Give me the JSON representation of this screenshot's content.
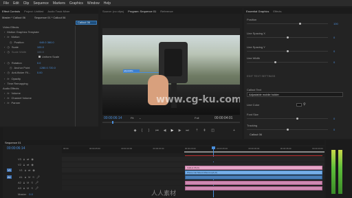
{
  "menubar": {
    "items": [
      "File",
      "Edit",
      "Clip",
      "Sequence",
      "Markers",
      "Graphics",
      "Window",
      "Help"
    ]
  },
  "effect_controls": {
    "tabs": [
      "Effect Controls",
      "Project: Untitled",
      "Audio Track Mixer"
    ],
    "header": {
      "master": "Master * Callout 06",
      "sequence": "Sequence 01 * Callout 06"
    },
    "clip_label": "Callout 06",
    "section_video": "Video Effects",
    "items": [
      {
        "label": "Motion Graphics Template",
        "value": ""
      },
      {
        "label": "Motion",
        "value": ""
      },
      {
        "label": "Position",
        "value": "640.0   360.0"
      },
      {
        "label": "Scale",
        "value": "100.0"
      },
      {
        "label": "Scale Width",
        "value": "100.0"
      },
      {
        "label": "Uniform Scale",
        "value": ""
      },
      {
        "label": "Rotation",
        "value": "0.0"
      },
      {
        "label": "Anchor Point",
        "value": "1280.0   720.0"
      },
      {
        "label": "Anti-flicker Fil...",
        "value": "0.00"
      },
      {
        "label": "Opacity",
        "value": ""
      },
      {
        "label": "Time Remapping",
        "value": ""
      }
    ],
    "section_audio": "Audio Effects",
    "audio_items": [
      "Volume",
      "Channel Volume",
      "Panner"
    ]
  },
  "program_monitor": {
    "tabs": [
      "Source: (no clips)",
      "Program: Sequence 01",
      "Reference"
    ],
    "timecode": "00:00:06:14",
    "fit": "Fit",
    "quality": "Full",
    "duration": "00:00:04:01",
    "watermark": "www.cg-ku.com",
    "callout_bar": "adjustable"
  },
  "essential_graphics": {
    "tabs": [
      "Essential Graphics",
      "Effects"
    ],
    "fields": [
      {
        "label": "Position",
        "value": "100"
      },
      {
        "label": "Line Spacing X",
        "value": "0"
      },
      {
        "label": "Line Spacing Y",
        "value": "0"
      },
      {
        "label": "Line Width",
        "value": "0"
      },
      {
        "label": "EDIT TEXT SETTINGS",
        "value": ""
      },
      {
        "label": "Callout Text",
        "value": "Adjustable mobile holder"
      },
      {
        "label": "Line Color",
        "value": ""
      },
      {
        "label": "Font Size",
        "value": "0"
      },
      {
        "label": "Tracking",
        "value": "0"
      }
    ],
    "footer_clip": "Callout 06"
  },
  "timeline": {
    "tab": "Sequence 01",
    "timecode": "00:00:06:14",
    "ruler": [
      "00:00",
      "00:00:05:00",
      "00:00:10:00",
      "00:00:15:00",
      "00:00:20:00",
      "00:00:25:00",
      "00:00:30:00",
      "00:00:35:00",
      "00:00:40:00"
    ],
    "tracks": [
      {
        "name": "V3",
        "kind": "video"
      },
      {
        "name": "V2",
        "kind": "video"
      },
      {
        "name": "V1",
        "kind": "video"
      },
      {
        "name": "A1",
        "kind": "audio"
      },
      {
        "name": "A2",
        "kind": "audio"
      },
      {
        "name": "A3",
        "kind": "audio"
      },
      {
        "name": "Master",
        "kind": "master"
      }
    ],
    "clips": [
      {
        "label": "Callout 06 [V]",
        "track": "V2"
      },
      {
        "label": "Phone Car Mount Mount.mp4 [V]",
        "track": "V1"
      }
    ],
    "master_value": "0.0"
  },
  "watermark_bottom": "人人素材",
  "colors": {
    "accent": "#4a8fdc",
    "clip_pink": "#e6a7c8",
    "clip_blue": "#76aee6",
    "playhead": "#4a8fdc",
    "meter_green": "#5fbf3a"
  }
}
